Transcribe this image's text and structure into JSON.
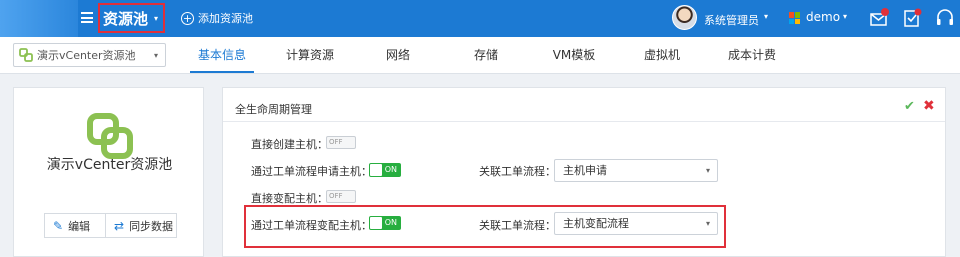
{
  "header": {
    "module_title": "资源池",
    "add_pool_label": "添加资源池",
    "user_name": "系统管理员",
    "tenant_name": "demo",
    "icons": [
      "menu-icon",
      "chevron-down-icon",
      "plus-circle-icon",
      "windows-icon",
      "mail-alert-icon",
      "approval-icon",
      "headset-icon"
    ],
    "colors": {
      "bar": "#1c7ad3",
      "alert": "#e0303a"
    }
  },
  "tabbar": {
    "pool_select_value": "演示vCenter资源池",
    "tabs": [
      {
        "label": "基本信息",
        "active": true
      },
      {
        "label": "计算资源",
        "active": false
      },
      {
        "label": "网络",
        "active": false
      },
      {
        "label": "存储",
        "active": false
      },
      {
        "label": "VM模板",
        "active": false
      },
      {
        "label": "虚拟机",
        "active": false
      },
      {
        "label": "成本计费",
        "active": false
      }
    ]
  },
  "pool_card": {
    "name": "演示vCenter资源池",
    "edit_label": "编辑",
    "sync_label": "同步数据"
  },
  "lifecycle": {
    "title": "全生命周期管理",
    "rows": [
      {
        "label": "直接创建主机：",
        "toggle": "OFF"
      },
      {
        "label": "通过工单流程申请主机：",
        "toggle": "ON",
        "flow_label": "关联工单流程：",
        "flow_value": "主机申请"
      },
      {
        "label": "直接变配主机：",
        "toggle": "OFF"
      },
      {
        "label": "通过工单流程变配主机：",
        "toggle": "ON",
        "flow_label": "关联工单流程：",
        "flow_value": "主机变配流程"
      }
    ],
    "colors": {
      "toggle_on": "#27ae3f",
      "confirm": "#5cb85c",
      "cancel": "#e0303a"
    }
  }
}
